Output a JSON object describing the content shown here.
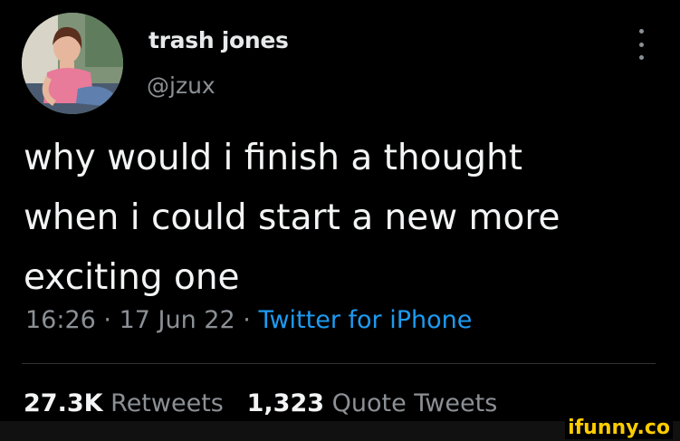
{
  "author": {
    "display_name": "trash jones",
    "handle": "@jzux"
  },
  "tweet": {
    "text": "why would i finish a thought\nwhen i could start a new more\nexciting one",
    "time": "16:26",
    "date": "17 Jun 22",
    "separator": "·",
    "source": "Twitter for iPhone"
  },
  "stats": {
    "retweets_count": "27.3K",
    "retweets_label": "Retweets",
    "quotes_count": "1,323",
    "quotes_label": "Quote Tweets"
  },
  "watermark": "ifunny.co",
  "colors": {
    "background": "#000000",
    "link": "#1d9bf0",
    "secondary_text": "#8b9095",
    "primary_text": "#e7e9ea",
    "watermark": "#ffcc00"
  },
  "icons": {
    "menu": "more-vertical-icon"
  }
}
